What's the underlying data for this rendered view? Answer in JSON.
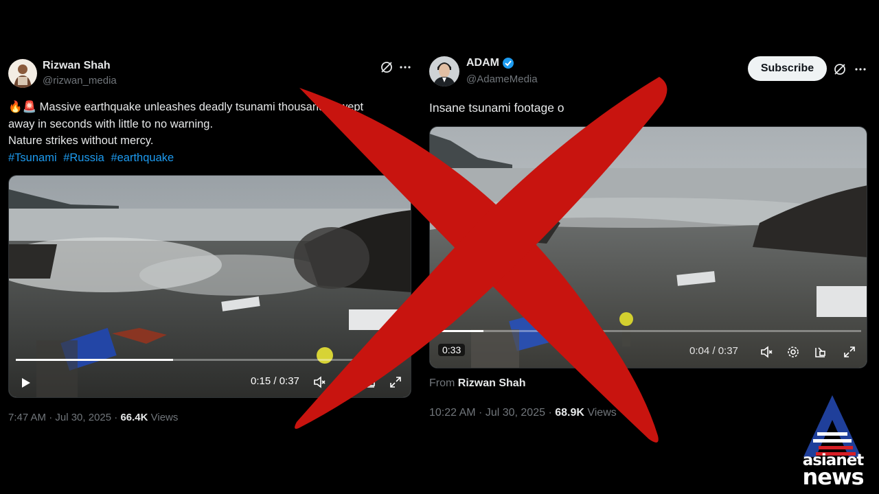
{
  "left_tweet": {
    "author_name": "Rizwan Shah",
    "author_handle": "@rizwan_media",
    "text_line1": "🔥🚨 Massive earthquake unleashes deadly tsunami thousands swept",
    "text_line2": "away in seconds with little to no warning.",
    "text_line3": "Nature strikes without mercy.",
    "hashtags": [
      "#Tsunami",
      "#Russia",
      "#earthquake"
    ],
    "video": {
      "time_display": "0:15 / 0:37",
      "progress_fraction": 0.405
    },
    "timestamp": "7:47 AM · Jul 30, 2025 · ",
    "views_count": "66.4K",
    "views_label": " Views"
  },
  "right_tweet": {
    "author_name": "ADAM",
    "author_handle": "@AdameMedia",
    "verified": true,
    "subscribe_label": "Subscribe",
    "text": "Insane tsunami footage o",
    "video": {
      "duration_badge": "0:33",
      "time_display": "0:04 / 0:37",
      "progress_fraction": 0.11
    },
    "from_label": "From ",
    "from_name": "Rizwan Shah",
    "timestamp": "10:22 AM · Jul 30, 2025 · ",
    "views_count": "68.9K",
    "views_label": " Views"
  },
  "overlay": {
    "cross_color": "#c8140f",
    "logo_line1": "asianet",
    "logo_line2": "news"
  },
  "colors": {
    "background": "#000000",
    "link": "#1d9bf0",
    "verified": "#1d9bf0",
    "muted": "#71767b"
  },
  "icons": [
    "grok-icon",
    "more-icon",
    "verified-badge-icon",
    "play-icon",
    "mute-icon",
    "settings-icon",
    "pip-icon",
    "fullscreen-icon"
  ]
}
